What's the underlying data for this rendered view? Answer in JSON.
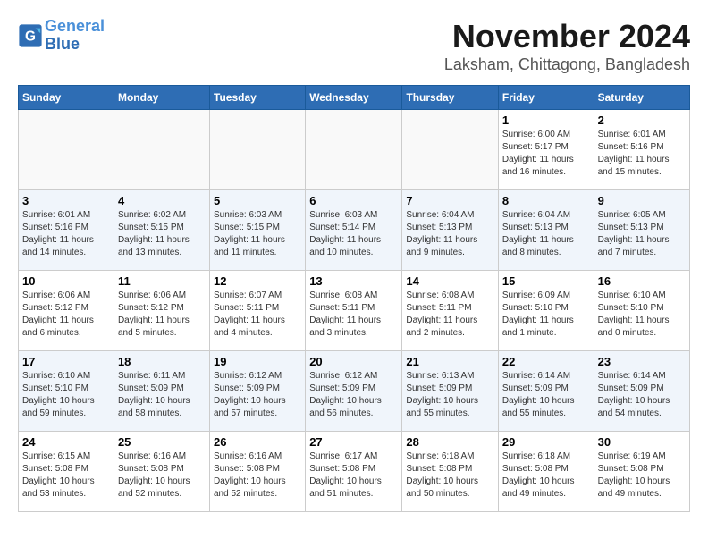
{
  "logo": {
    "line1": "General",
    "line2": "Blue"
  },
  "header": {
    "month_year": "November 2024",
    "location": "Laksham, Chittagong, Bangladesh"
  },
  "weekdays": [
    "Sunday",
    "Monday",
    "Tuesday",
    "Wednesday",
    "Thursday",
    "Friday",
    "Saturday"
  ],
  "weeks": [
    [
      {
        "day": "",
        "info": ""
      },
      {
        "day": "",
        "info": ""
      },
      {
        "day": "",
        "info": ""
      },
      {
        "day": "",
        "info": ""
      },
      {
        "day": "",
        "info": ""
      },
      {
        "day": "1",
        "info": "Sunrise: 6:00 AM\nSunset: 5:17 PM\nDaylight: 11 hours\nand 16 minutes."
      },
      {
        "day": "2",
        "info": "Sunrise: 6:01 AM\nSunset: 5:16 PM\nDaylight: 11 hours\nand 15 minutes."
      }
    ],
    [
      {
        "day": "3",
        "info": "Sunrise: 6:01 AM\nSunset: 5:16 PM\nDaylight: 11 hours\nand 14 minutes."
      },
      {
        "day": "4",
        "info": "Sunrise: 6:02 AM\nSunset: 5:15 PM\nDaylight: 11 hours\nand 13 minutes."
      },
      {
        "day": "5",
        "info": "Sunrise: 6:03 AM\nSunset: 5:15 PM\nDaylight: 11 hours\nand 11 minutes."
      },
      {
        "day": "6",
        "info": "Sunrise: 6:03 AM\nSunset: 5:14 PM\nDaylight: 11 hours\nand 10 minutes."
      },
      {
        "day": "7",
        "info": "Sunrise: 6:04 AM\nSunset: 5:13 PM\nDaylight: 11 hours\nand 9 minutes."
      },
      {
        "day": "8",
        "info": "Sunrise: 6:04 AM\nSunset: 5:13 PM\nDaylight: 11 hours\nand 8 minutes."
      },
      {
        "day": "9",
        "info": "Sunrise: 6:05 AM\nSunset: 5:13 PM\nDaylight: 11 hours\nand 7 minutes."
      }
    ],
    [
      {
        "day": "10",
        "info": "Sunrise: 6:06 AM\nSunset: 5:12 PM\nDaylight: 11 hours\nand 6 minutes."
      },
      {
        "day": "11",
        "info": "Sunrise: 6:06 AM\nSunset: 5:12 PM\nDaylight: 11 hours\nand 5 minutes."
      },
      {
        "day": "12",
        "info": "Sunrise: 6:07 AM\nSunset: 5:11 PM\nDaylight: 11 hours\nand 4 minutes."
      },
      {
        "day": "13",
        "info": "Sunrise: 6:08 AM\nSunset: 5:11 PM\nDaylight: 11 hours\nand 3 minutes."
      },
      {
        "day": "14",
        "info": "Sunrise: 6:08 AM\nSunset: 5:11 PM\nDaylight: 11 hours\nand 2 minutes."
      },
      {
        "day": "15",
        "info": "Sunrise: 6:09 AM\nSunset: 5:10 PM\nDaylight: 11 hours\nand 1 minute."
      },
      {
        "day": "16",
        "info": "Sunrise: 6:10 AM\nSunset: 5:10 PM\nDaylight: 11 hours\nand 0 minutes."
      }
    ],
    [
      {
        "day": "17",
        "info": "Sunrise: 6:10 AM\nSunset: 5:10 PM\nDaylight: 10 hours\nand 59 minutes."
      },
      {
        "day": "18",
        "info": "Sunrise: 6:11 AM\nSunset: 5:09 PM\nDaylight: 10 hours\nand 58 minutes."
      },
      {
        "day": "19",
        "info": "Sunrise: 6:12 AM\nSunset: 5:09 PM\nDaylight: 10 hours\nand 57 minutes."
      },
      {
        "day": "20",
        "info": "Sunrise: 6:12 AM\nSunset: 5:09 PM\nDaylight: 10 hours\nand 56 minutes."
      },
      {
        "day": "21",
        "info": "Sunrise: 6:13 AM\nSunset: 5:09 PM\nDaylight: 10 hours\nand 55 minutes."
      },
      {
        "day": "22",
        "info": "Sunrise: 6:14 AM\nSunset: 5:09 PM\nDaylight: 10 hours\nand 55 minutes."
      },
      {
        "day": "23",
        "info": "Sunrise: 6:14 AM\nSunset: 5:09 PM\nDaylight: 10 hours\nand 54 minutes."
      }
    ],
    [
      {
        "day": "24",
        "info": "Sunrise: 6:15 AM\nSunset: 5:08 PM\nDaylight: 10 hours\nand 53 minutes."
      },
      {
        "day": "25",
        "info": "Sunrise: 6:16 AM\nSunset: 5:08 PM\nDaylight: 10 hours\nand 52 minutes."
      },
      {
        "day": "26",
        "info": "Sunrise: 6:16 AM\nSunset: 5:08 PM\nDaylight: 10 hours\nand 52 minutes."
      },
      {
        "day": "27",
        "info": "Sunrise: 6:17 AM\nSunset: 5:08 PM\nDaylight: 10 hours\nand 51 minutes."
      },
      {
        "day": "28",
        "info": "Sunrise: 6:18 AM\nSunset: 5:08 PM\nDaylight: 10 hours\nand 50 minutes."
      },
      {
        "day": "29",
        "info": "Sunrise: 6:18 AM\nSunset: 5:08 PM\nDaylight: 10 hours\nand 49 minutes."
      },
      {
        "day": "30",
        "info": "Sunrise: 6:19 AM\nSunset: 5:08 PM\nDaylight: 10 hours\nand 49 minutes."
      }
    ]
  ]
}
